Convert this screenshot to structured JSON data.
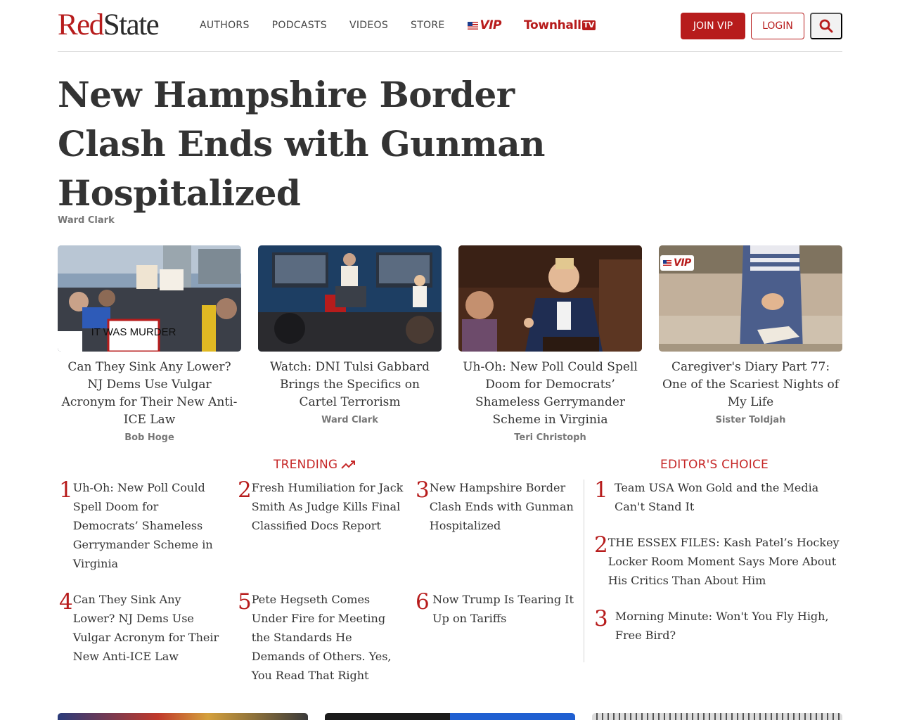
{
  "brand": {
    "logo_red": "Red",
    "logo_dark": "State"
  },
  "nav": {
    "items": [
      "AUTHORS",
      "PODCASTS",
      "VIDEOS",
      "STORE"
    ],
    "vip_label": "VIP",
    "townhall_label": "Townhall",
    "townhall_tv": "TV"
  },
  "header_actions": {
    "join_vip": "JOIN VIP",
    "login": "LOGIN"
  },
  "hero": {
    "title": "New Hampshire Border Clash Ends with Gunman Hospitalized",
    "author": "Ward Clark"
  },
  "cards": [
    {
      "title": "Can They Sink Any Lower? NJ Dems Use Vulgar Acronym for Their New Anti-ICE Law",
      "author": "Bob Hoge",
      "image": "protest-photo",
      "sign_text": "IT WAS MURDER"
    },
    {
      "title": "Watch: DNI Tulsi Gabbard Brings the Specifics on Cartel Terrorism",
      "author": "Ward Clark",
      "image": "press-briefing-photo"
    },
    {
      "title": "Uh-Oh: New Poll Could Spell Doom for Democrats’ Shameless Gerrymander Scheme in Virginia",
      "author": "Teri Christoph",
      "image": "speaker-photo"
    },
    {
      "title": "Caregiver's Diary Part 77: One of the Scariest Nights of My Life",
      "author": "Sister Toldjah",
      "image": "praying-hands-photo",
      "badge": "VIP"
    }
  ],
  "trending": {
    "heading": "TRENDING",
    "items": [
      {
        "num": "1",
        "title": "Uh-Oh: New Poll Could Spell Doom for Democrats’ Shameless Gerrymander Scheme in Virginia"
      },
      {
        "num": "2",
        "title": "Fresh Humiliation for Jack Smith As Judge Kills Final Classified Docs Report"
      },
      {
        "num": "3",
        "title": "New Hampshire Border Clash Ends with Gunman Hospitalized"
      },
      {
        "num": "4",
        "title": "Can They Sink Any Lower? NJ Dems Use Vulgar Acronym for Their New Anti-ICE Law"
      },
      {
        "num": "5",
        "title": "Pete Hegseth Comes Under Fire for Meeting the Standards He Demands of Others. Yes, You Read That Right"
      },
      {
        "num": "6",
        "title": "Now Trump Is Tearing It Up on Tariffs"
      }
    ]
  },
  "editors_choice": {
    "heading": "EDITOR'S CHOICE",
    "items": [
      {
        "num": "1",
        "title": "Team USA Won Gold and the Media Can't Stand It"
      },
      {
        "num": "2",
        "title": "THE ESSEX FILES: Kash Patel’s Hockey Locker Room Moment Says More About His Critics Than About Him"
      },
      {
        "num": "3",
        "title": "Morning Minute: Won't You Fly High, Free Bird?"
      }
    ]
  },
  "colors": {
    "brand_red": "#b71c1c",
    "text": "#333333",
    "muted": "#777777"
  }
}
